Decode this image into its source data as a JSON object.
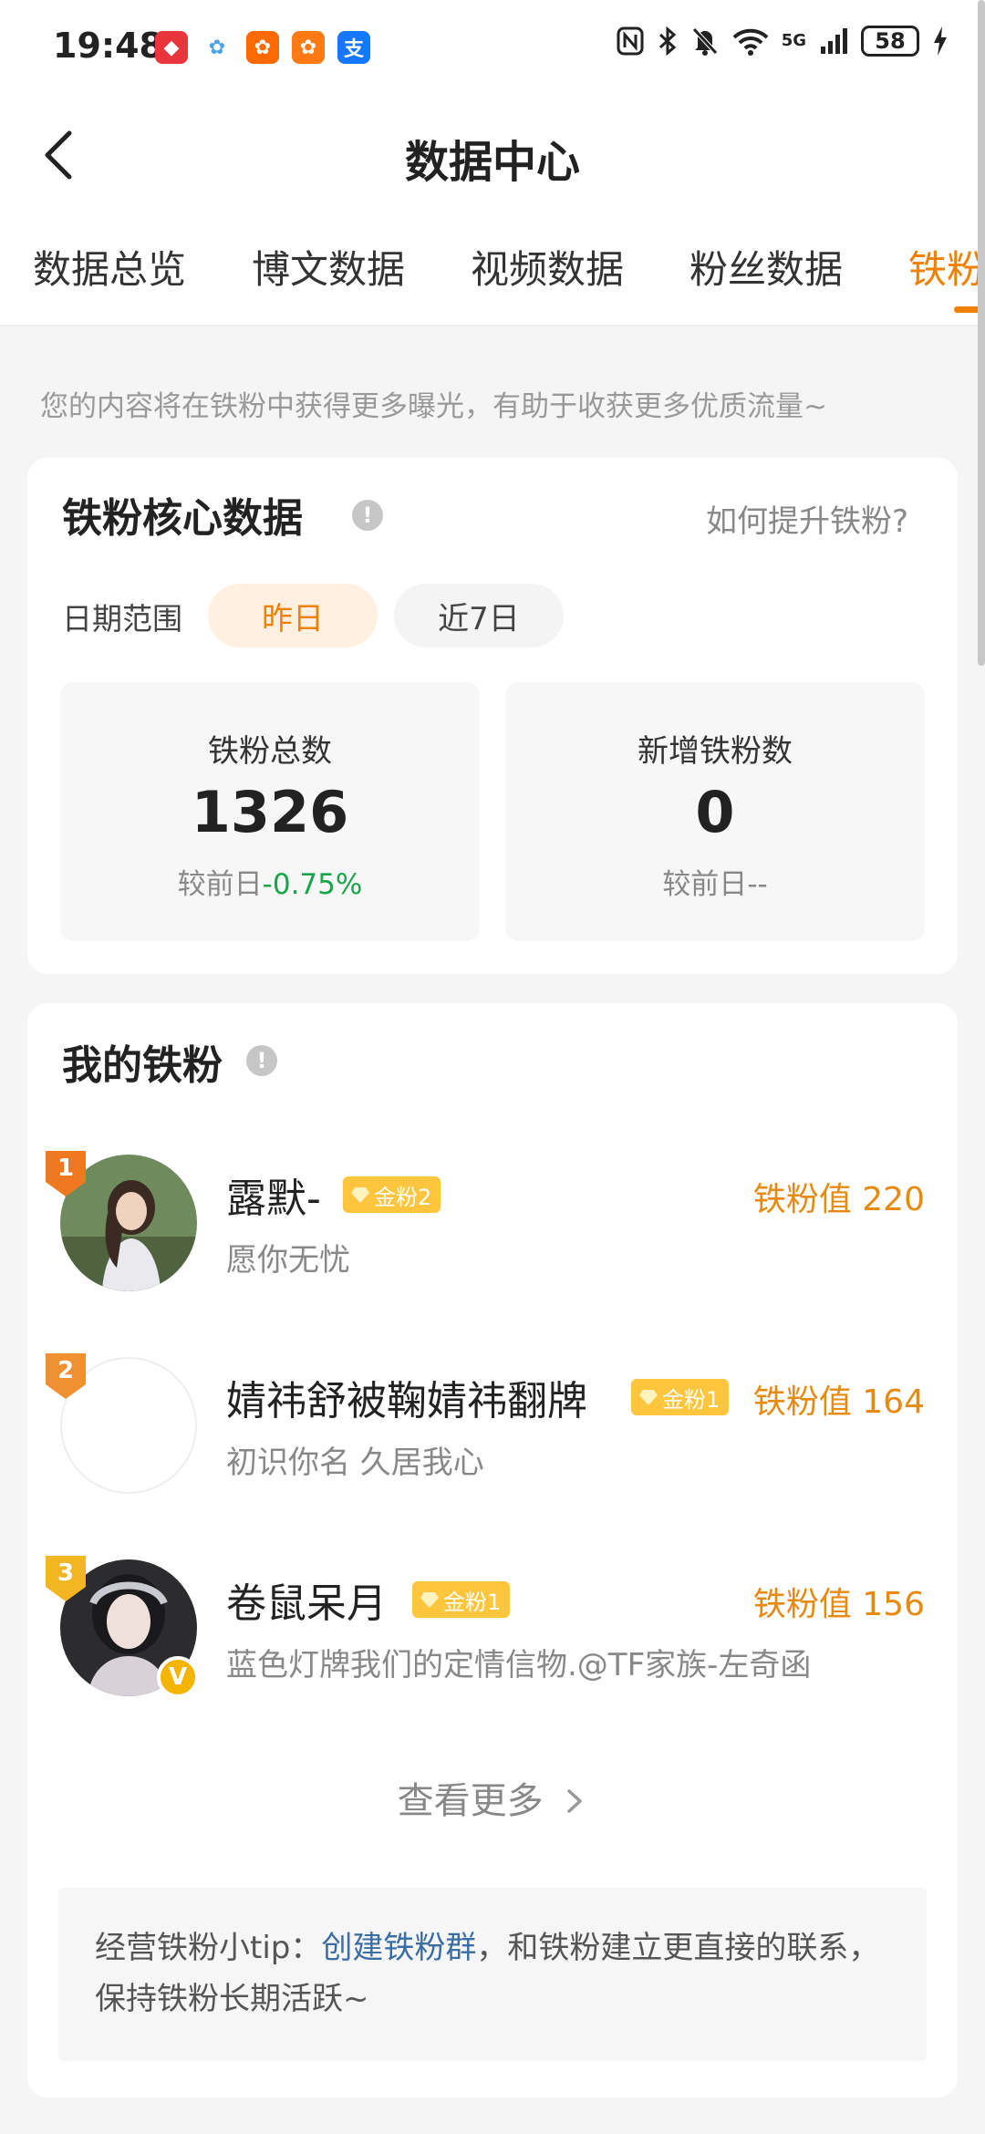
{
  "status_bar": {
    "time": "19:48",
    "battery": "58",
    "app_icons": [
      {
        "name": "huawei-icon",
        "glyph": "◆",
        "color": "#e8343b"
      },
      {
        "name": "pinwheel-icon",
        "glyph": "✿",
        "color": "#4aa3e8"
      },
      {
        "name": "taobao-icon",
        "glyph": "✿",
        "color": "#ff6a00"
      },
      {
        "name": "paw-icon",
        "glyph": "✿",
        "color": "#ff7a12"
      },
      {
        "name": "alipay-icon",
        "glyph": "支",
        "color": "#1677ff"
      }
    ],
    "signal_label": "5G"
  },
  "header": {
    "title": "数据中心"
  },
  "tabs": [
    {
      "label": "数据总览",
      "active": false
    },
    {
      "label": "博文数据",
      "active": false
    },
    {
      "label": "视频数据",
      "active": false
    },
    {
      "label": "粉丝数据",
      "active": false
    },
    {
      "label": "铁粉",
      "active": true
    }
  ],
  "intro_text": "您的内容将在铁粉中获得更多曝光，有助于收获更多优质流量~",
  "core_card": {
    "title": "铁粉核心数据",
    "info_glyph": "!",
    "how_link": "如何提升铁粉?",
    "date_label": "日期范围",
    "chips": [
      {
        "label": "昨日",
        "active": true
      },
      {
        "label": "近7日",
        "active": false
      }
    ],
    "stats": [
      {
        "label": "铁粉总数",
        "value": "1326",
        "compare_label": "较前日",
        "delta": "-0.75%"
      },
      {
        "label": "新增铁粉数",
        "value": "0",
        "compare_label": "较前日",
        "delta": "--"
      }
    ]
  },
  "fans_card": {
    "title": "我的铁粉",
    "info_glyph": "!",
    "fans": [
      {
        "rank": "1",
        "name": "露默-",
        "level": "金粉2",
        "bio": "愿你无忧",
        "score": "铁粉值 220"
      },
      {
        "rank": "2",
        "name": "婧祎舒被鞠婧祎翻牌",
        "level": "金粉1",
        "bio": "初识你名 久居我心",
        "score": "铁粉值 164"
      },
      {
        "rank": "3",
        "name": "卷鼠呆月",
        "level": "金粉1",
        "bio": "蓝色灯牌我们的定情信物.@TF家族-左奇函",
        "score": "铁粉值 156",
        "verified": "V"
      }
    ],
    "see_more": "查看更多",
    "tip_prefix": "经营铁粉小tip：",
    "tip_link": "创建铁粉群",
    "tip_suffix": "，和铁粉建立更直接的联系，保持铁粉长期活跃~"
  },
  "colors": {
    "accent": "#f08000",
    "score": "#e78a12",
    "positive_delta": "#1aa54a",
    "gold_badge": "#ffc53d",
    "link": "#3a6ea5"
  }
}
